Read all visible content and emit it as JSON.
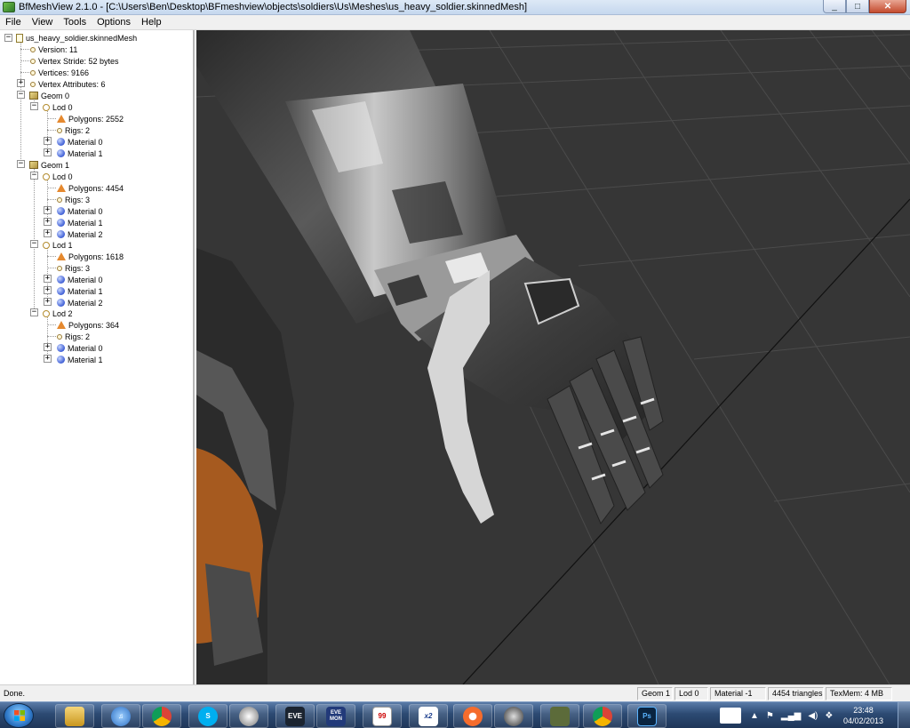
{
  "window": {
    "title": "BfMeshView 2.1.0 - [C:\\Users\\Ben\\Desktop\\BFmeshview\\objects\\soldiers\\Us\\Meshes\\us_heavy_soldier.skinnedMesh]",
    "minimize": "_",
    "maximize": "□",
    "close": "✕"
  },
  "menu": [
    "File",
    "View",
    "Tools",
    "Options",
    "Help"
  ],
  "tree": {
    "root": "us_heavy_soldier.skinnedMesh",
    "version": "Version: 11",
    "vertex_stride": "Vertex Stride: 52 bytes",
    "vertices": "Vertices: 9166",
    "vertex_attributes": "Vertex Attributes: 6",
    "geom0": {
      "label": "Geom 0",
      "lod0": {
        "label": "Lod 0",
        "polygons": "Polygons: 2552",
        "rigs": "Rigs: 2",
        "materials": [
          "Material 0",
          "Material 1"
        ]
      }
    },
    "geom1": {
      "label": "Geom 1",
      "lod0": {
        "label": "Lod 0",
        "polygons": "Polygons: 4454",
        "rigs": "Rigs: 3",
        "materials": [
          "Material 0",
          "Material 1",
          "Material 2"
        ]
      },
      "lod1": {
        "label": "Lod 1",
        "polygons": "Polygons: 1618",
        "rigs": "Rigs: 3",
        "materials": [
          "Material 0",
          "Material 1",
          "Material 2"
        ]
      },
      "lod2": {
        "label": "Lod 2",
        "polygons": "Polygons: 364",
        "rigs": "Rigs: 2",
        "materials": [
          "Material 0",
          "Material 1"
        ]
      }
    }
  },
  "status": {
    "text": "Done.",
    "geom": "Geom 1",
    "lod": "Lod 0",
    "material": "Material -1",
    "triangles": "4454 triangles",
    "texmem": "TexMem: 4 MB"
  },
  "taskbar": {
    "apps": [
      {
        "icon": "explorer-icon",
        "label": ""
      },
      {
        "icon": "itunes-icon",
        "label": "♫"
      },
      {
        "icon": "chrome-icon",
        "label": ""
      },
      {
        "icon": "skype-icon",
        "label": "S"
      },
      {
        "icon": "headset-icon",
        "label": ""
      },
      {
        "icon": "eve-icon",
        "label": "EVE"
      },
      {
        "icon": "evemon-icon",
        "label": "EVE MON"
      },
      {
        "icon": "notepad-icon",
        "label": "99"
      },
      {
        "icon": "x2-icon",
        "label": "x2"
      },
      {
        "icon": "origin-icon",
        "label": ""
      },
      {
        "icon": "steam-icon",
        "label": ""
      },
      {
        "icon": "tank-icon",
        "label": ""
      },
      {
        "icon": "chrome2-icon",
        "label": ""
      },
      {
        "icon": "photoshop-icon",
        "label": "Ps"
      }
    ],
    "time": "23:48",
    "date": "04/02/2013"
  },
  "colors": {
    "viewport_bg": "#363636",
    "grid_line": "#4a4a4a"
  }
}
